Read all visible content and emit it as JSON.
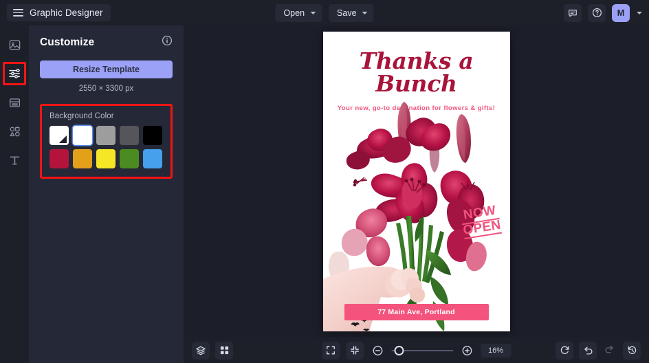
{
  "header": {
    "menu_icon": "hamburger-icon",
    "brand": "Graphic Designer",
    "open_label": "Open",
    "save_label": "Save",
    "comment_icon": "comment-icon",
    "help_icon": "help-icon",
    "avatar_initial": "M",
    "avatar_color": "#9ba1f7"
  },
  "rail": {
    "items": [
      {
        "name": "image-icon",
        "label": "Image"
      },
      {
        "name": "customize-sliders-icon",
        "label": "Customize"
      },
      {
        "name": "layout-icon",
        "label": "Layout"
      },
      {
        "name": "shapes-icon",
        "label": "Shapes"
      },
      {
        "name": "text-icon",
        "label": "Text"
      }
    ],
    "active_index": 1,
    "highlight_color": "#f41414"
  },
  "panel": {
    "title": "Customize",
    "info_icon": "info-icon",
    "resize_label": "Resize Template",
    "resize_color": "#9ba1f7",
    "dimensions": "2550 × 3300 px",
    "background": {
      "label": "Background Color",
      "highlight_color": "#f41414",
      "selected_index": 1,
      "swatches": [
        {
          "name": "swatch-transparent",
          "color": "#ffffff",
          "corner": true
        },
        {
          "name": "swatch-white",
          "color": "#ffffff"
        },
        {
          "name": "swatch-gray",
          "color": "#9d9d9d"
        },
        {
          "name": "swatch-dark-gray",
          "color": "#55555a"
        },
        {
          "name": "swatch-black",
          "color": "#000000"
        },
        {
          "name": "swatch-crimson",
          "color": "#b4143c"
        },
        {
          "name": "swatch-orange",
          "color": "#e3a019"
        },
        {
          "name": "swatch-yellow",
          "color": "#f5e626"
        },
        {
          "name": "swatch-green",
          "color": "#4a8c1f"
        },
        {
          "name": "swatch-blue",
          "color": "#46a0eb"
        }
      ]
    }
  },
  "poster": {
    "title": "Thanks a Bunch",
    "subtitle": "Your new, go-to destination for flowers & gifts!",
    "badge_line1": "NOW",
    "badge_line2": "OPEN",
    "address": "77 Main Ave, Portland",
    "title_color": "#a8143a",
    "accent_color": "#f0547e",
    "banner_color": "#f4537e"
  },
  "bottombar": {
    "layers_icon": "layers-icon",
    "grid_icon": "grid-icon",
    "fit_icon": "expand-fullscreen-icon",
    "shrink_icon": "collapse-icon",
    "zoom_out_icon": "zoom-out-icon",
    "zoom_in_icon": "zoom-in-icon",
    "zoom_value": "16%",
    "reset_icon": "refresh-icon",
    "undo_icon": "undo-icon",
    "redo_icon": "redo-icon",
    "history_icon": "history-icon"
  }
}
